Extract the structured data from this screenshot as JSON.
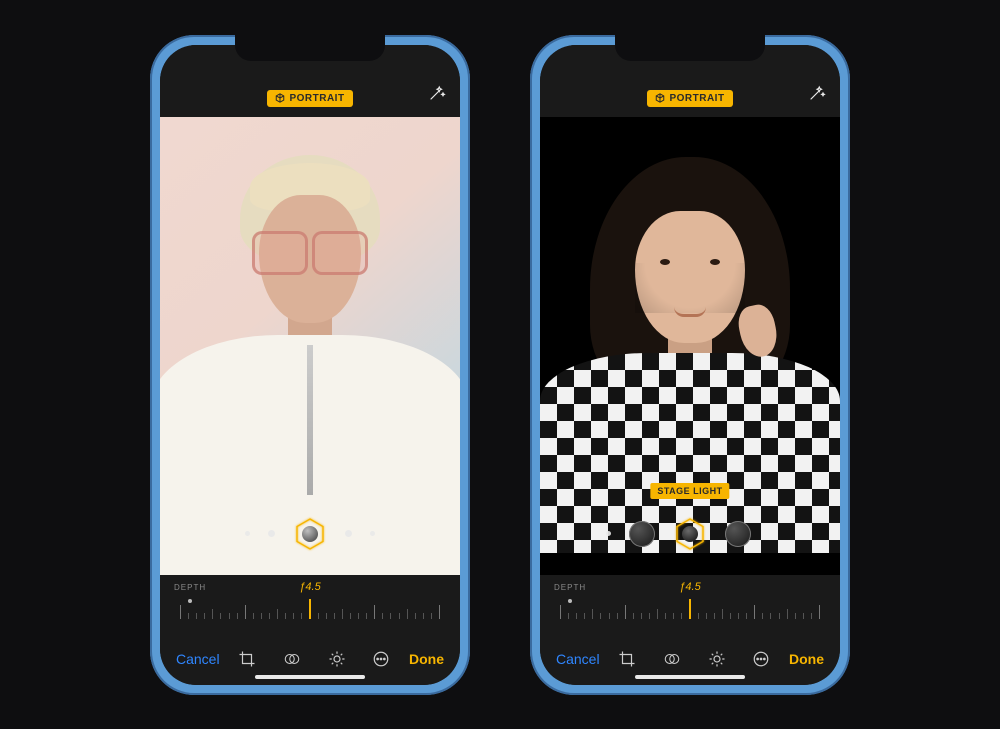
{
  "colors": {
    "accent": "#f7b500",
    "link": "#2f86ff"
  },
  "phones": [
    {
      "badge": {
        "icon": "cube-icon",
        "text": "PORTRAIT"
      },
      "effect_label": null,
      "depth": {
        "label": "DEPTH",
        "f_value": "ƒ4.5"
      },
      "toolbar": {
        "cancel": "Cancel",
        "done": "Done",
        "icons": [
          "crop-icon",
          "filters-icon",
          "adjust-icon",
          "more-icon"
        ]
      }
    },
    {
      "badge": {
        "icon": "cube-icon",
        "text": "PORTRAIT"
      },
      "effect_label": "STAGE LIGHT",
      "depth": {
        "label": "DEPTH",
        "f_value": "ƒ4.5"
      },
      "toolbar": {
        "cancel": "Cancel",
        "done": "Done",
        "icons": [
          "crop-icon",
          "filters-icon",
          "adjust-icon",
          "more-icon"
        ]
      }
    }
  ]
}
